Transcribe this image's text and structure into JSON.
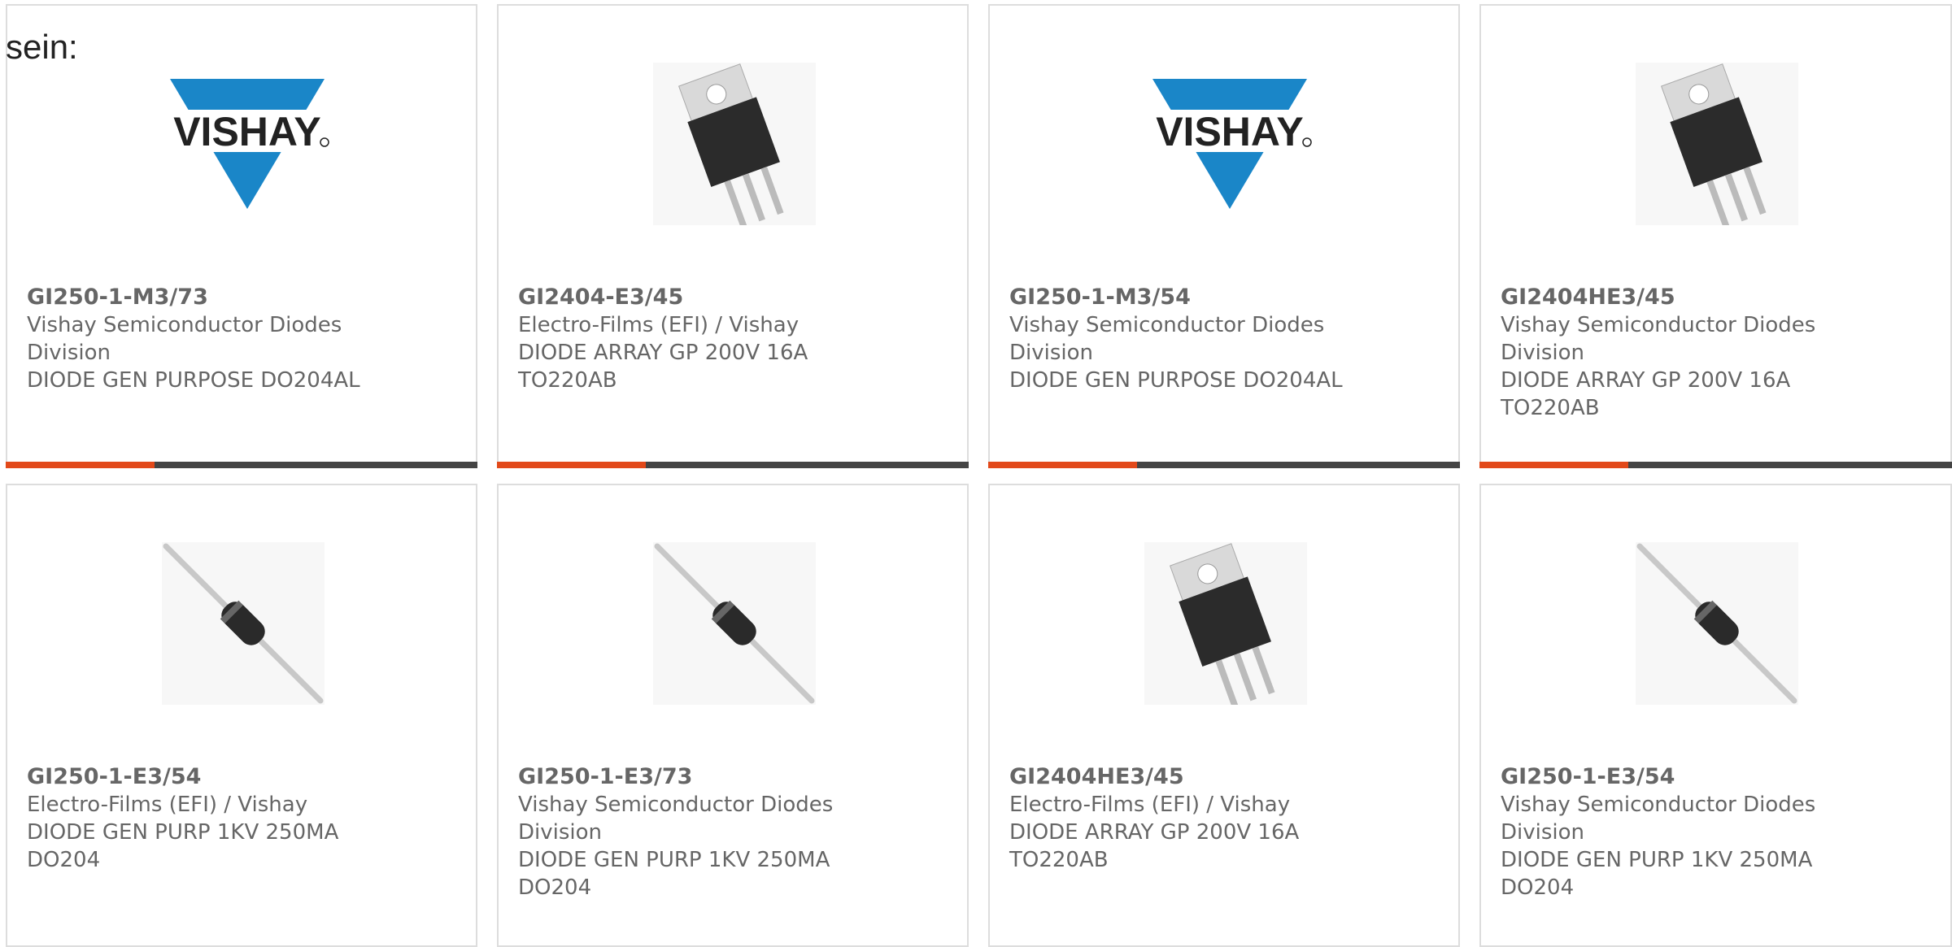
{
  "page": {
    "heading": "sein:"
  },
  "products": [
    {
      "name": "GI250-1-M3/73",
      "manufacturer": "Vishay Semiconductor Diodes Division",
      "description": "DIODE GEN PURPOSE DO204AL",
      "image": "vishay-logo"
    },
    {
      "name": "GI2404-E3/45",
      "manufacturer": "Electro-Films (EFI) / Vishay",
      "description": "DIODE ARRAY GP 200V 16A TO220AB",
      "image": "to220"
    },
    {
      "name": "GI250-1-M3/54",
      "manufacturer": "Vishay Semiconductor Diodes Division",
      "description": "DIODE GEN PURPOSE DO204AL",
      "image": "vishay-logo"
    },
    {
      "name": "GI2404HE3/45",
      "manufacturer": "Vishay Semiconductor Diodes Division",
      "description": "DIODE ARRAY GP 200V 16A TO220AB",
      "image": "to220"
    },
    {
      "name": "GI250-1-E3/54",
      "manufacturer": "Electro-Films (EFI) / Vishay",
      "description": "DIODE GEN PURP 1KV 250MA DO204",
      "image": "axial-diode"
    },
    {
      "name": "GI250-1-E3/73",
      "manufacturer": "Vishay Semiconductor Diodes Division",
      "description": "DIODE GEN PURP 1KV 250MA DO204",
      "image": "axial-diode"
    },
    {
      "name": "GI2404HE3/45",
      "manufacturer": "Electro-Films (EFI) / Vishay",
      "description": "DIODE ARRAY GP 200V 16A TO220AB",
      "image": "to220"
    },
    {
      "name": "GI250-1-E3/54",
      "manufacturer": "Vishay Semiconductor Diodes Division",
      "description": "DIODE GEN PURP 1KV 250MA DO204",
      "image": "axial-diode"
    }
  ],
  "logo_text": "VISHAY",
  "colors": {
    "accent": "#e2491a",
    "bar": "#444444",
    "border": "#dddddd",
    "vishay_blue": "#1a86c8"
  }
}
